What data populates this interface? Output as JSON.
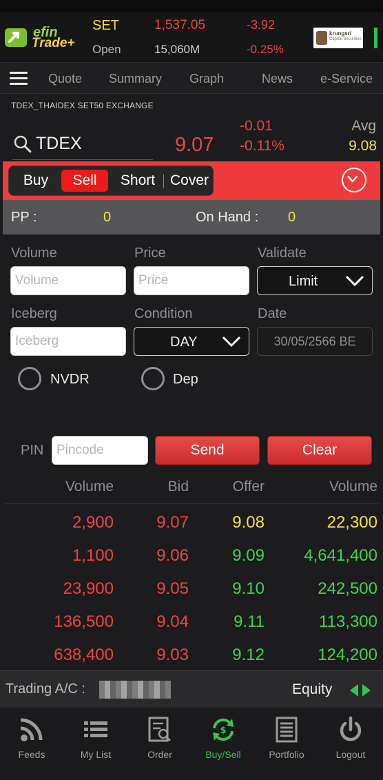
{
  "header": {
    "brand_top": "efin",
    "brand_bottom": "Trade+",
    "index_name": "SET",
    "index_value": "1,537.05",
    "index_change": "-3.92",
    "session_label": "Open",
    "volume": "15,060M",
    "percent_change": "-0.25%",
    "broker_name": "krungsri",
    "broker_sub": "Capital Securities"
  },
  "nav": {
    "tabs": [
      "Quote",
      "Summary",
      "Graph",
      "News",
      "e-Service"
    ]
  },
  "instrument": {
    "title": "TDEX_THAIDEX SET50 EXCHANGE",
    "symbol": "TDEX",
    "last": "9.07",
    "change": "-0.01",
    "percent_change": "-0.11%",
    "avg_label": "Avg",
    "avg_value": "9.08"
  },
  "actions": {
    "buy": "Buy",
    "sell": "Sell",
    "short": "Short",
    "cover": "Cover",
    "selected": "Sell"
  },
  "pp": {
    "pp_label": "PP :",
    "pp_value": "0",
    "onhand_label": "On Hand :",
    "onhand_value": "0"
  },
  "form": {
    "volume_label": "Volume",
    "volume_placeholder": "Volume",
    "price_label": "Price",
    "price_placeholder": "Price",
    "validate_label": "Validate",
    "validate_value": "Limit",
    "iceberg_label": "Iceberg",
    "iceberg_placeholder": "Iceberg",
    "condition_label": "Condition",
    "condition_value": "DAY",
    "date_label": "Date",
    "date_value": "30/05/2566 BE",
    "nvdr_label": "NVDR",
    "dep_label": "Dep",
    "pin_label": "PIN",
    "pin_placeholder": "Pincode",
    "send": "Send",
    "clear": "Clear"
  },
  "book": {
    "headers": [
      "Volume",
      "Bid",
      "Offer",
      "Volume"
    ],
    "rows": [
      {
        "bid_vol": "2,900",
        "bid": "9.07",
        "offer": "9.08",
        "offer_vol": "22,300",
        "offer_color": "#f3e048"
      },
      {
        "bid_vol": "1,100",
        "bid": "9.06",
        "offer": "9.09",
        "offer_vol": "4,641,400",
        "offer_color": "#3ed34e"
      },
      {
        "bid_vol": "23,900",
        "bid": "9.05",
        "offer": "9.10",
        "offer_vol": "242,500",
        "offer_color": "#3ed34e"
      },
      {
        "bid_vol": "136,500",
        "bid": "9.04",
        "offer": "9.11",
        "offer_vol": "113,300",
        "offer_color": "#3ed34e"
      },
      {
        "bid_vol": "638,400",
        "bid": "9.03",
        "offer": "9.12",
        "offer_vol": "124,200",
        "offer_color": "#3ed34e"
      }
    ],
    "bid_color": "#ee4343"
  },
  "account": {
    "label": "Trading A/C :",
    "type": "Equity"
  },
  "tabbar": {
    "items": [
      {
        "label": "Feeds",
        "icon": "rss-icon"
      },
      {
        "label": "My List",
        "icon": "list-icon"
      },
      {
        "label": "Order",
        "icon": "order-doc-icon"
      },
      {
        "label": "Buy/Sell",
        "icon": "buy-sell-icon"
      },
      {
        "label": "Portfolio",
        "icon": "portfolio-icon"
      },
      {
        "label": "Logout",
        "icon": "power-icon"
      }
    ],
    "active": "Buy/Sell"
  },
  "colors": {
    "accent_red": "#ef3b3b",
    "up_green": "#3ed34e",
    "highlight_yellow": "#f3e048"
  }
}
